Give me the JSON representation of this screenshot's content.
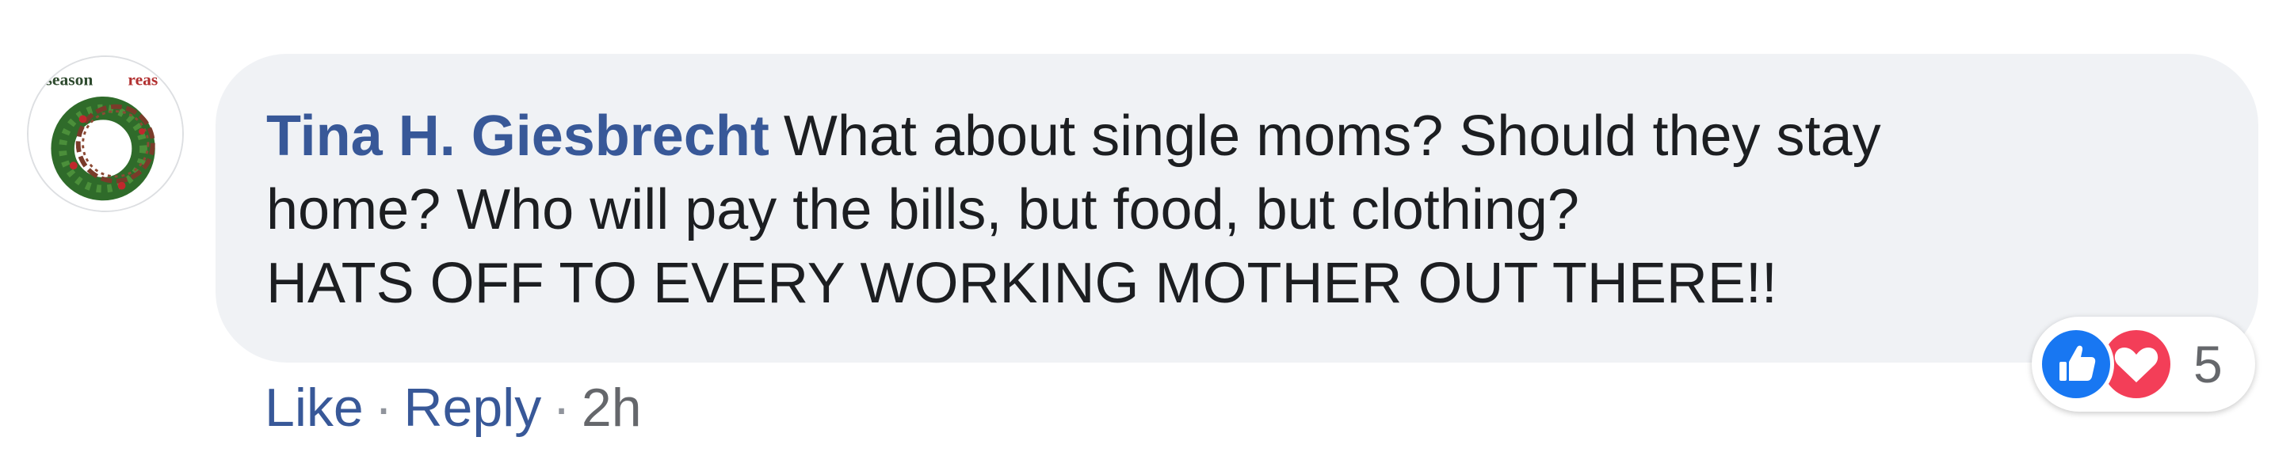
{
  "comment": {
    "author": "Tina H. Giesbrecht",
    "text_lines": [
      "What about single moms? Should they stay",
      "home? Who will pay the bills, but food, but clothing?",
      "HATS OFF TO EVERY WORKING MOTHER OUT THERE!!"
    ]
  },
  "avatar": {
    "icon": "wreath-avatar-icon",
    "text_left": "season",
    "text_right": "reas"
  },
  "reactions": {
    "icons": [
      "like-icon",
      "love-icon"
    ],
    "count": "5",
    "colors": {
      "like": "#1877f2",
      "love": "#f33e58"
    }
  },
  "actions": {
    "like_label": "Like",
    "reply_label": "Reply",
    "separator": "·",
    "timestamp": "2h"
  },
  "colors": {
    "author": "#385898",
    "link": "#385898",
    "bubble": "#f0f2f5",
    "text": "#1c1e21",
    "meta": "#65676b"
  }
}
